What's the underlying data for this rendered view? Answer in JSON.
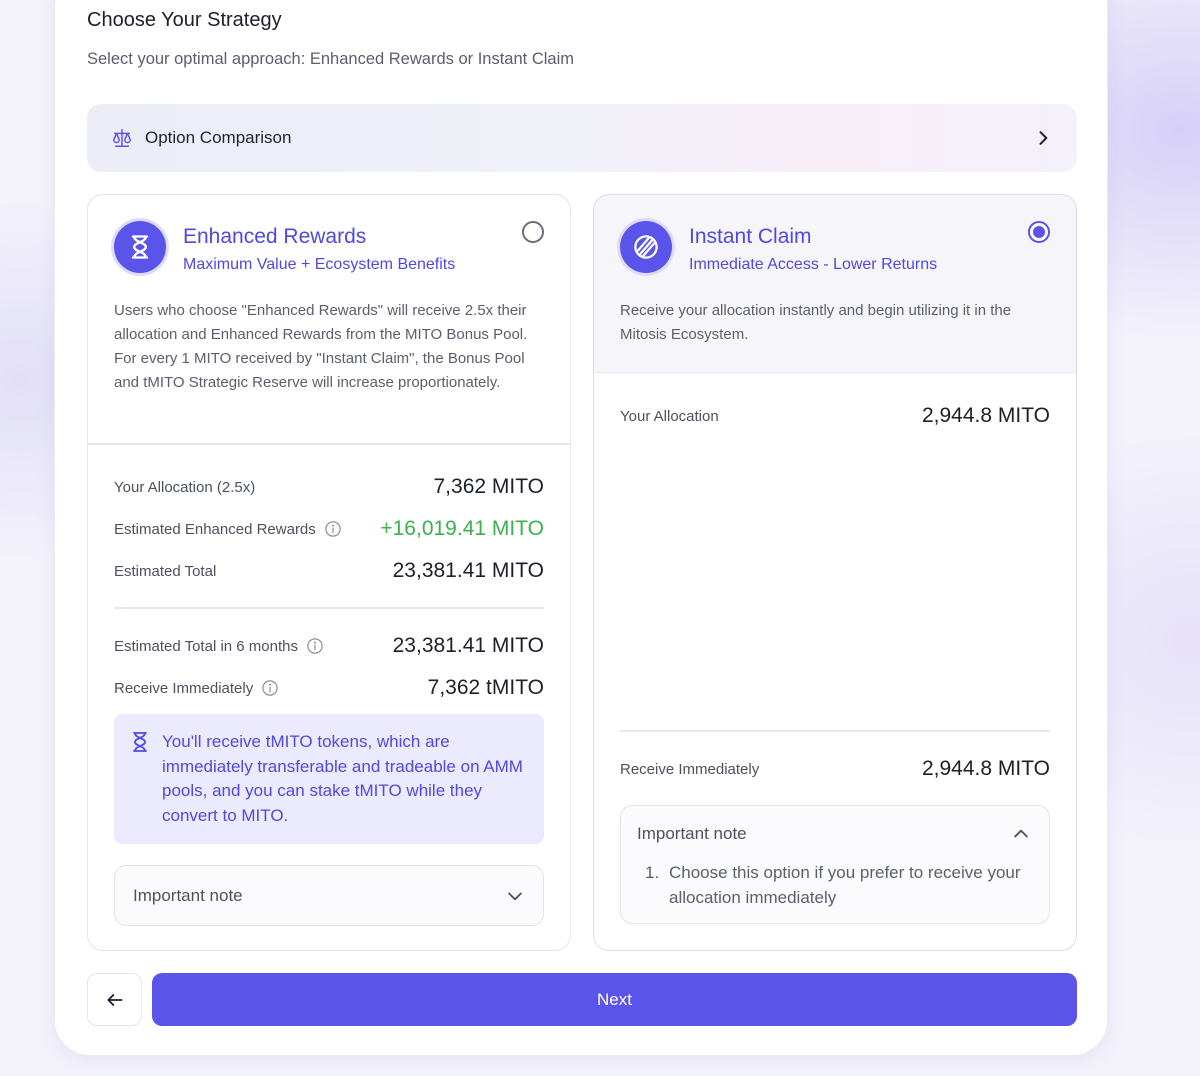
{
  "header": {
    "title": "Choose Your Strategy",
    "subtitle": "Select your optimal approach: Enhanced Rewards or Instant Claim"
  },
  "comparison": {
    "label": "Option Comparison",
    "icon": "scale-icon"
  },
  "enhanced": {
    "name": "Enhanced Rewards",
    "tagline": "Maximum Value + Ecosystem Benefits",
    "selected": false,
    "description": "Users who choose \"Enhanced Rewards\" will receive 2.5x their allocation and Enhanced Rewards from the MITO Bonus Pool. For every 1 MITO received by \"Instant Claim\", the Bonus Pool and tMITO Strategic Reserve will increase proportionately.",
    "rows": [
      {
        "label": "Your Allocation (2.5x)",
        "value": "7,362 MITO"
      },
      {
        "label": "Estimated Enhanced Rewards",
        "value": "+16,019.41 MITO"
      },
      {
        "label": "Estimated Total",
        "value": "23,381.41 MITO"
      },
      {
        "label": "Estimated Total in 6 months",
        "value": "23,381.41 MITO"
      },
      {
        "label": "Receive Immediately",
        "value": "7,362 tMITO"
      }
    ],
    "callout": "You'll receive tMITO tokens, which are immediately transferable and tradeable on AMM pools, and you can stake tMITO while they convert to MITO.",
    "note_title": "Important note"
  },
  "instant": {
    "name": "Instant Claim",
    "tagline": "Immediate Access - Lower Returns",
    "selected": true,
    "description": "Receive your allocation instantly and begin utilizing it in the Mitosis Ecosystem.",
    "allocation_label": "Your Allocation",
    "allocation_value": "2,944.8 MITO",
    "receive_label": "Receive Immediately",
    "receive_value": "2,944.8 MITO",
    "note_title": "Important note",
    "note_items": [
      {
        "num": "1.",
        "text": "Choose this option if you prefer to receive your allocation immediately"
      }
    ]
  },
  "footer": {
    "next_label": "Next"
  },
  "colors": {
    "accent": "#5a54ea",
    "accent_text": "#4f49e0",
    "positive": "#3cb04e"
  }
}
